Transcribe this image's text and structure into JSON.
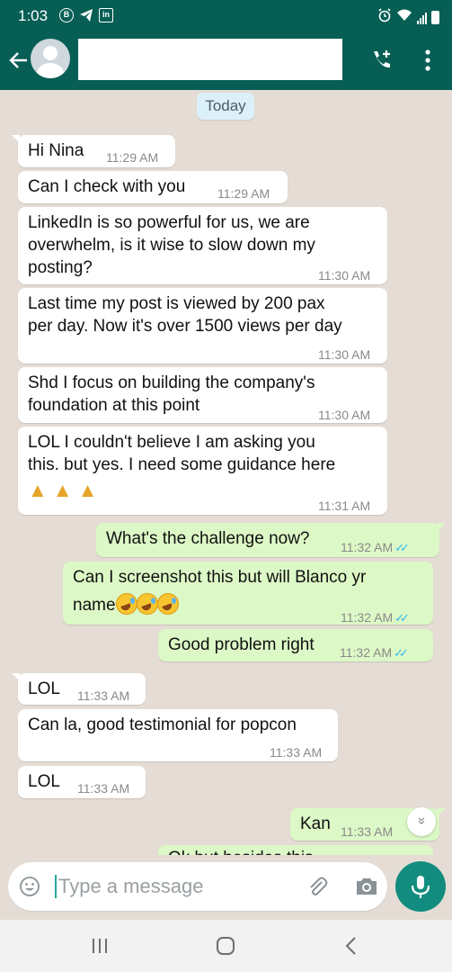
{
  "status_bar": {
    "time": "1:03",
    "icon_b": "B",
    "icon_in": "in",
    "icons": [
      "b-circle-icon",
      "telegram-icon",
      "linkedin-icon",
      "alarm-icon",
      "wifi-icon",
      "signal-icon",
      "battery-icon"
    ]
  },
  "header": {
    "contact_name": "",
    "icons": [
      "back-arrow-icon",
      "avatar-icon",
      "add-call-icon",
      "more-vert-icon"
    ]
  },
  "chat": {
    "date_chip": "Today",
    "messages": [
      {
        "dir": "in",
        "text": "Hi Nina",
        "time": "11:29 AM"
      },
      {
        "dir": "in",
        "text": "Can I check with you",
        "time": "11:29 AM"
      },
      {
        "dir": "in",
        "text": "LinkedIn is so powerful for us, we are overwhelm, is it wise to slow down my posting?",
        "time": "11:30 AM"
      },
      {
        "dir": "in",
        "text": "Last time my post is viewed by 200 pax per day. Now it's over 1500 views per day",
        "time": "11:30 AM"
      },
      {
        "dir": "in",
        "text": "Shd I focus on building the company's foundation at this point",
        "time": "11:30 AM"
      },
      {
        "dir": "in",
        "text": "LOL I couldn't believe I am asking you this. but yes. I need some guidance here",
        "emoji": "🙏🙏🙏",
        "time": "11:31 AM"
      },
      {
        "dir": "out",
        "text": "What's the challenge now?",
        "time": "11:32 AM",
        "status": "read"
      },
      {
        "dir": "out",
        "text": "Can I screenshot this but will Blanco yr name",
        "emoji": "🤣🤣🤣",
        "time": "11:32 AM",
        "status": "read"
      },
      {
        "dir": "out",
        "text": "Good problem right",
        "time": "11:32 AM",
        "status": "read"
      },
      {
        "dir": "in",
        "text": "LOL",
        "time": "11:33 AM"
      },
      {
        "dir": "in",
        "text": "Can la, good testimonial for popcon",
        "time": "11:33 AM"
      },
      {
        "dir": "in",
        "text": "LOL",
        "time": "11:33 AM"
      },
      {
        "dir": "out",
        "text": "Kan",
        "time": "11:33 AM"
      },
      {
        "dir": "out",
        "text": "Ok but besides this",
        "partial": true
      }
    ],
    "message_lines": {
      "m2": [
        "LinkedIn is so powerful for us, we are",
        "overwhelm, is it wise to slow down my",
        "posting?"
      ],
      "m3": [
        "Last time my post is viewed by 200 pax",
        "per day. Now it's over 1500 views per day"
      ],
      "m4": [
        "Shd I focus on building the company's",
        "foundation at this point"
      ],
      "m5": [
        "LOL I couldn't believe I am asking you",
        "this. but yes. I need some guidance here"
      ],
      "m7": [
        "Can I screenshot this but will Blanco yr",
        "name"
      ]
    },
    "read_ticks": "✓✓",
    "scroll_icon": "chevron-double-down-icon",
    "scroll_glyph": "»"
  },
  "input": {
    "placeholder": "Type a message",
    "value": "",
    "icons": [
      "emoji-icon",
      "attach-icon",
      "camera-icon",
      "mic-icon"
    ]
  },
  "nav": {
    "icons": [
      "recent-apps-icon",
      "home-icon",
      "back-icon"
    ]
  },
  "colors": {
    "header": "#075e54",
    "wallpaper": "#e5ddd5",
    "incoming": "#ffffff",
    "outgoing": "#dcf8c6",
    "read_tick": "#34b7f1",
    "mic": "#128c7e",
    "date_chip": "#dcf0f9"
  }
}
